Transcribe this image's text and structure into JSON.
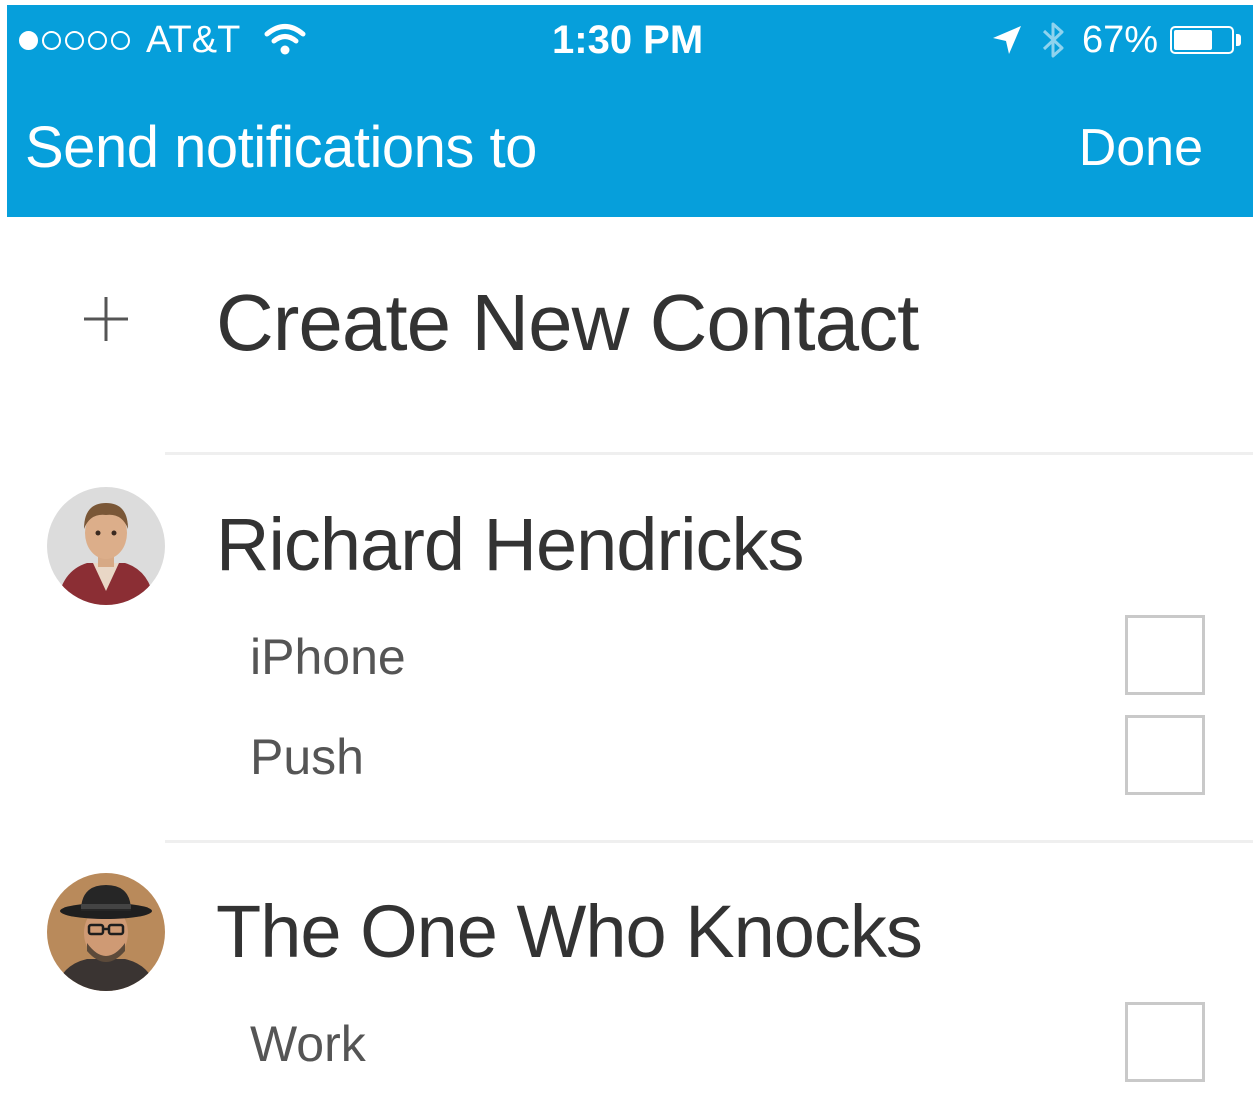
{
  "status_bar": {
    "carrier": "AT&T",
    "time": "1:30 PM",
    "battery": "67%",
    "battery_level": 0.67,
    "signal_bars_filled": 1,
    "signal_bars_total": 5,
    "icons": [
      "wifi-icon",
      "location-arrow-icon",
      "bluetooth-icon",
      "battery-icon"
    ]
  },
  "nav": {
    "title": "Send notifications to",
    "done_label": "Done",
    "background": "#069fdb"
  },
  "create_contact": {
    "icon": "plus-icon",
    "label": "Create New Contact"
  },
  "contacts": [
    {
      "name": "Richard Hendricks",
      "channels": [
        {
          "label": "iPhone",
          "checked": false
        },
        {
          "label": "Push",
          "checked": false
        }
      ]
    },
    {
      "name": "The One Who Knocks",
      "channels": [
        {
          "label": "Work",
          "checked": false
        }
      ]
    }
  ]
}
